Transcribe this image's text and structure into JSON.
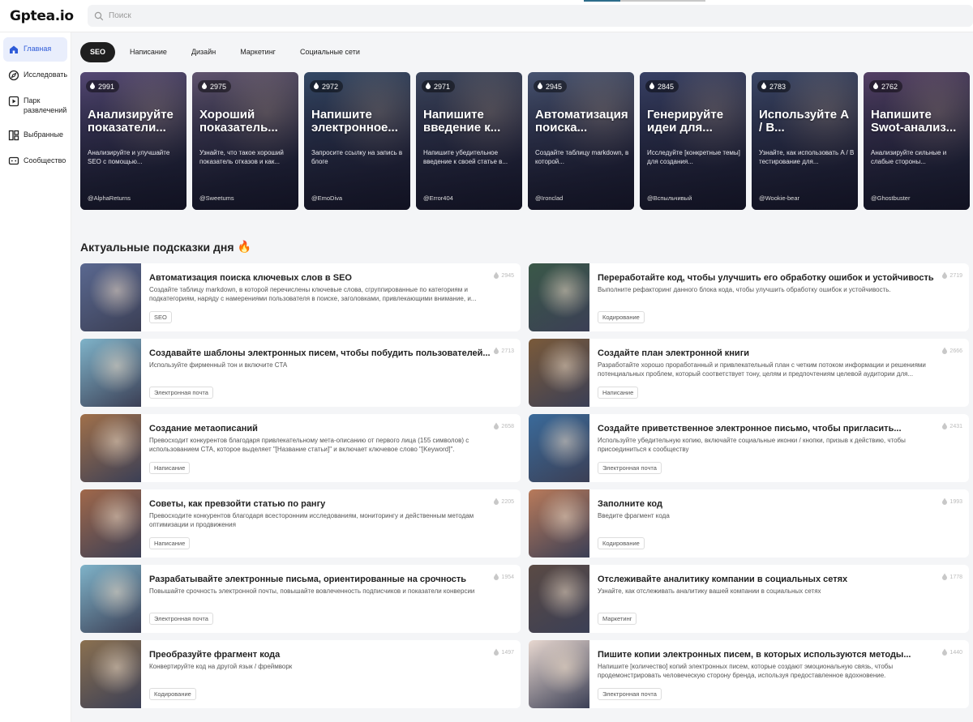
{
  "app": {
    "logo": "Gptea.io"
  },
  "search": {
    "placeholder": "Поиск"
  },
  "sidebar": {
    "items": [
      {
        "label": "Главная",
        "icon": "home-icon"
      },
      {
        "label": "Исследовать",
        "icon": "compass-icon"
      },
      {
        "label": "Парк развлечений",
        "icon": "play-icon"
      },
      {
        "label": "Выбранные",
        "icon": "grid-icon"
      },
      {
        "label": "Сообщество",
        "icon": "chat-icon"
      }
    ]
  },
  "tabs": [
    {
      "label": "SEO"
    },
    {
      "label": "Написание"
    },
    {
      "label": "Дизайн"
    },
    {
      "label": "Маркетинг"
    },
    {
      "label": "Социальные сети"
    }
  ],
  "featured": [
    {
      "views": "2991",
      "title": "Анализируйте показатели...",
      "desc": "Анализируйте и улучшайте SEO с помощью...",
      "author": "@AlphaReturns",
      "color": "#6b5a8e"
    },
    {
      "views": "2975",
      "title": "Хороший показатель...",
      "desc": "Узнайте, что такое хороший показатель отказов и как...",
      "author": "@Sweetums",
      "color": "#7a6a86"
    },
    {
      "views": "2972",
      "title": "Напишите электронное...",
      "desc": "Запросите ссылку на запись в блоге",
      "author": "@EmoDiva",
      "color": "#3f5a7a"
    },
    {
      "views": "2971",
      "title": "Напишите введение к...",
      "desc": "Напишите убедительное введение к своей статье в...",
      "author": "@Error404",
      "color": "#4b5870"
    },
    {
      "views": "2945",
      "title": "Автоматизация поиска...",
      "desc": "Создайте таблицу markdown, в которой...",
      "author": "@Ironclad",
      "color": "#5a6a8a"
    },
    {
      "views": "2845",
      "title": "Генерируйте идеи для...",
      "desc": "Исследуйте [конкретные темы] для создания...",
      "author": "@Вспыльчивый",
      "color": "#44507a"
    },
    {
      "views": "2783",
      "title": "Используйте A / B...",
      "desc": "Узнайте, как использовать A / B тестирование для...",
      "author": "@Wookie-bear",
      "color": "#4a5a7e"
    },
    {
      "views": "2762",
      "title": "Напишите Swot-анализ...",
      "desc": "Анализируйте сильные и слабые стороны...",
      "author": "@Ghostbuster",
      "color": "#6a4f7a"
    }
  ],
  "section": {
    "title": "Актуальные подсказки дня",
    "emoji": "🔥"
  },
  "prompts": [
    {
      "title": "Автоматизация поиска ключевых слов в SEO",
      "desc": "Создайте таблицу markdown, в которой перечислены ключевые слова, сгруппированные по категориям и подкатегориям, наряду с намерениями пользователя в поиске, заголовками, привлекающими внимание, и...",
      "tag": "SEO",
      "count": "2945",
      "color": "#5a6890"
    },
    {
      "title": "Переработайте код, чтобы улучшить его обработку ошибок и устойчивость",
      "desc": "Выполните рефакторинг данного блока кода, чтобы улучшить обработку ошибок и устойчивость.",
      "tag": "Кодирование",
      "count": "2719",
      "color": "#3a5848"
    },
    {
      "title": "Создавайте шаблоны электронных писем, чтобы побудить пользователей...",
      "desc": "Используйте фирменный тон и включите CTA",
      "tag": "Электронная почта",
      "count": "2713",
      "color": "#7fb3c9"
    },
    {
      "title": "Создайте план электронной книги",
      "desc": "Разработайте хорошо проработанный и привлекательный план с четким потоком информации и решениями потенциальных проблем, который соответствует тону, целям и предпочтениям целевой аудитории для...",
      "tag": "Написание",
      "count": "2666",
      "color": "#7a5a3a"
    },
    {
      "title": "Создание метаописаний",
      "desc": "Превосходит конкурентов благодаря привлекательному мета-описанию от первого лица (155 символов) с использованием CTA, которое выделяет \"[Название статьи]\" и включает ключевое слово \"[Keyword]\".",
      "tag": "Написание",
      "count": "2658",
      "color": "#a0704a"
    },
    {
      "title": "Создайте приветственное электронное письмо, чтобы пригласить...",
      "desc": "Используйте убедительную копию, включайте социальные иконки / кнопки, призыв к действию, чтобы присоединиться к сообществу",
      "tag": "Электронная почта",
      "count": "2431",
      "color": "#3a6a9a"
    },
    {
      "title": "Советы, как превзойти статью по рангу",
      "desc": "Превосходите конкурентов благодаря всесторонним исследованиям, мониторингу и действенным методам оптимизации и продвижения",
      "tag": "Написание",
      "count": "2205",
      "color": "#a0684a"
    },
    {
      "title": "Заполните код",
      "desc": "Введите фрагмент кода",
      "tag": "Кодирование",
      "count": "1993",
      "color": "#b87a5a"
    },
    {
      "title": "Разрабатывайте электронные письма, ориентированные на срочность",
      "desc": "Повышайте срочность электронной почты, повышайте вовлеченность подписчиков и показатели конверсии",
      "tag": "Электронная почта",
      "count": "1954",
      "color": "#7fb3c9"
    },
    {
      "title": "Отслеживайте аналитику компании в социальных сетях",
      "desc": "Узнайте, как отслеживать аналитику вашей компании в социальных сетях",
      "tag": "Маркетинг",
      "count": "1778",
      "color": "#5a4a44"
    },
    {
      "title": "Преобразуйте фрагмент кода",
      "desc": "Конвертируйте код на другой язык / фреймворк",
      "tag": "Кодирование",
      "count": "1497",
      "color": "#8a7050"
    },
    {
      "title": "Пишите копии электронных писем, в которых используются методы...",
      "desc": "Напишите [количество] копий электронных писем, которые создают эмоциональную связь, чтобы продемонстрировать человеческую сторону бренда, используя предоставленное вдохновение.",
      "tag": "Электронная почта",
      "count": "1440",
      "color": "#e8d8d0"
    }
  ]
}
